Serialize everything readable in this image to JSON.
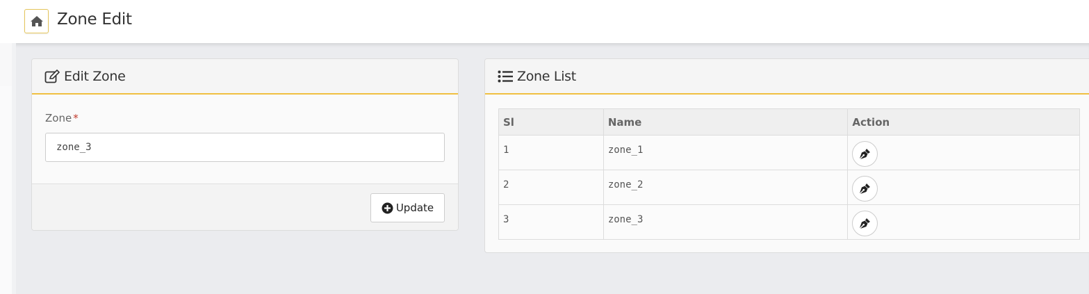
{
  "page": {
    "title": "Zone Edit"
  },
  "edit_card": {
    "title": "Edit Zone",
    "field_label": "Zone",
    "required_mark": "*",
    "input_value": "zone_3",
    "update_label": "Update"
  },
  "list_card": {
    "title": "Zone List",
    "columns": [
      "Sl",
      "Name",
      "Action"
    ],
    "rows": [
      {
        "sl": "1",
        "name": "zone_1"
      },
      {
        "sl": "2",
        "name": "zone_2"
      },
      {
        "sl": "3",
        "name": "zone_3"
      }
    ]
  },
  "icons": {
    "home": "home-icon",
    "edit_zone": "edit-square-icon",
    "zone_list": "list-icon",
    "update": "plus-circle-icon",
    "row_action": "pen-nib-icon"
  },
  "colors": {
    "accent": "#f0c040",
    "required": "#c0392b",
    "background": "#ebecef"
  }
}
